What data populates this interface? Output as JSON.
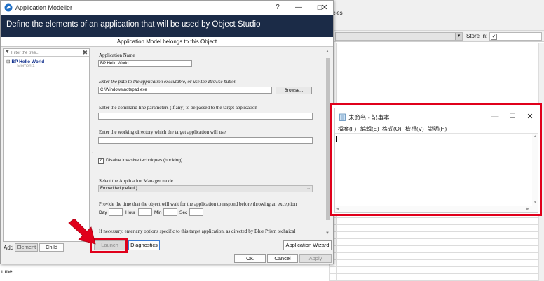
{
  "background": {
    "tab_fragment": "ncies",
    "store_in_label": "Store In:",
    "bottom_fragment": "ume"
  },
  "dialog": {
    "title": "Application Modeller",
    "help_glyph": "?",
    "banner": "Define the elements of an application that will be used by Object Studio",
    "model_header": "Application Model belongs to this Object",
    "tree": {
      "filter_placeholder": "Filter the tree...",
      "root": "BP Hello World",
      "child": "Element1"
    },
    "add_label": "Add",
    "element_button": "Element",
    "child_button": "Child",
    "form": {
      "app_name_label": "Application Name",
      "app_name_value": "BP Hello World",
      "path_label": "Enter the path to the application executable, or use the Browse button",
      "path_value": "C:\\Windows\\notepad.exe",
      "browse_button": "Browse...",
      "cmdline_label": "Enter the command line parameters (if any) to be passed to the target application",
      "cmdline_value": "",
      "workdir_label": "Enter the working directory which the target application will use",
      "workdir_value": "",
      "hooking_label": "Disable invasive techniques (hooking)",
      "manager_mode_label": "Select the Application Manager mode",
      "manager_mode_value": "Embedded (default)",
      "timeout_label": "Provide the time that the object will wait for the application to respond before throwing an exception",
      "day_label": "Day",
      "hour_label": "Hour",
      "min_label": "Min",
      "sec_label": "Sec",
      "options_label": "If necessary, enter any options specific to this target application, as directed by Blue Prism technical"
    },
    "buttons": {
      "launch": "Launch",
      "diagnostics": "Diagnostics",
      "wizard": "Application Wizard",
      "ok": "OK",
      "cancel": "Cancel",
      "apply": "Apply"
    }
  },
  "notepad": {
    "title": "未命名 - 記事本",
    "menu": [
      "檔案(F)",
      "編輯(E)",
      "格式(O)",
      "檢視(V)",
      "說明(H)"
    ]
  },
  "colors": {
    "banner": "#1b2b47",
    "highlight": "#e0001b",
    "focus_border": "#3a7bd5"
  }
}
